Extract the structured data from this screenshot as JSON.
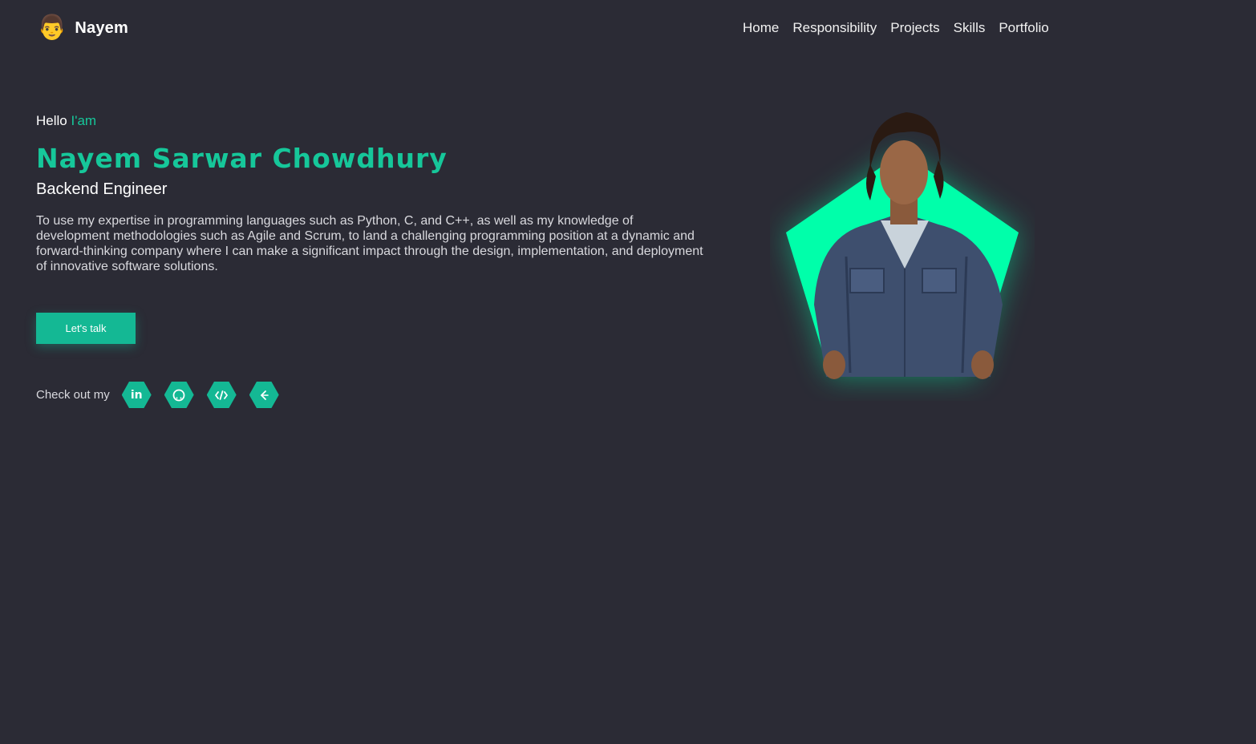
{
  "header": {
    "brand_emoji": "👨",
    "brand_name": "Nayem",
    "nav": [
      "Home",
      "Responsibility",
      "Projects",
      "Skills",
      "Portfolio"
    ]
  },
  "hero": {
    "greeting": "Hello",
    "greeting_accent": "I'am",
    "name": "Nayem Sarwar Chowdhury",
    "role": "Backend Engineer",
    "summary": "To use my expertise in programming languages such as Python, C, and C++, as well as my knowledge of development methodologies such as Agile and Scrum, to land a challenging programming position at a dynamic and forward-thinking company where I can make a significant impact through the design, implementation, and deployment of innovative software solutions.",
    "cta_label": "Let's talk",
    "social_label": "Check out my",
    "social_icons": [
      "linkedin-icon",
      "github-icon",
      "code-icon",
      "leetcode-icon"
    ]
  },
  "colors": {
    "background": "#2b2b35",
    "accent": "#16c79a",
    "button": "#14b894",
    "pentagon": "#00ffaa"
  }
}
